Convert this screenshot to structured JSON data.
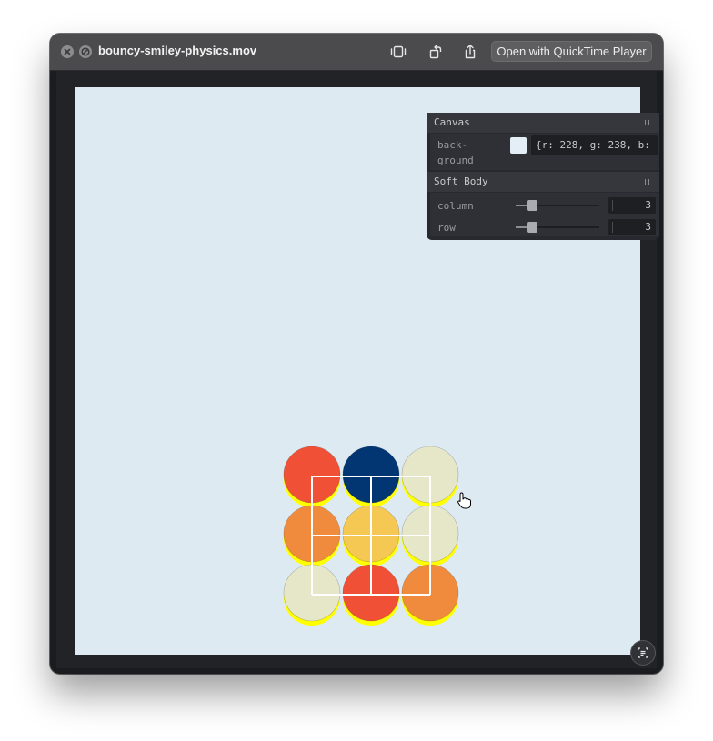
{
  "window": {
    "title": "bouncy-smiley-physics.mov",
    "open_with_label": "Open with QuickTime Player"
  },
  "toolbar_icons": [
    "trim-icon",
    "rotate-icon",
    "share-icon"
  ],
  "gui_panel": {
    "canvas_section": {
      "title": "Canvas",
      "background_label_line1": "back-",
      "background_label_line2": "ground",
      "background_value": "{r: 228, g: 238, b:",
      "background_color": "#e4eef6"
    },
    "softbody_section": {
      "title": "Soft Body",
      "column_label": "column",
      "column_value": "3",
      "column_fraction": 0.2,
      "row_label": "row",
      "row_value": "3",
      "row_fraction": 0.2
    }
  },
  "scene": {
    "grid": {
      "columns": 3,
      "rows": 3
    },
    "ball_colors": [
      [
        "#f05035",
        "#023673",
        "#e6e6c9"
      ],
      [
        "#f08b3e",
        "#f5c853",
        "#e6e6c9"
      ],
      [
        "#e6e6c9",
        "#f05035",
        "#f08b3e"
      ]
    ],
    "ball_shadow_color": "#ffff00"
  },
  "colors": {
    "canvas_background": "#deeaf2",
    "titlebar": "#4b4b4d",
    "panel": "#28292e"
  }
}
